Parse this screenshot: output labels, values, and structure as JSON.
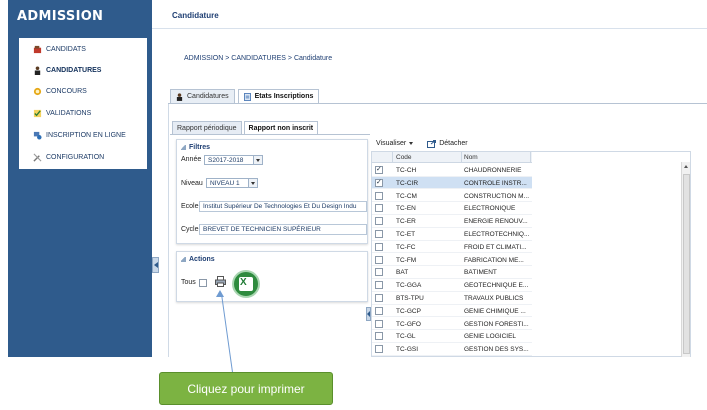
{
  "app": {
    "brand": "ADMISSION"
  },
  "sidebar": {
    "items": [
      {
        "label": "CANDIDATS",
        "icon": "candidates-icon",
        "active": false
      },
      {
        "label": "CANDIDATURES",
        "icon": "person-icon",
        "active": true
      },
      {
        "label": "CONCOURS",
        "icon": "contest-icon",
        "active": false
      },
      {
        "label": "VALIDATIONS",
        "icon": "validation-icon",
        "active": false
      },
      {
        "label": "INSCRIPTION EN LIGNE",
        "icon": "online-registration-icon",
        "active": false
      },
      {
        "label": "CONFIGURATION",
        "icon": "tools-icon",
        "active": false
      }
    ]
  },
  "header": {
    "title": "Candidature",
    "breadcrumb": "ADMISSION > CANDIDATURES > Candidature"
  },
  "tabs": [
    {
      "label": "Candidatures",
      "active": false
    },
    {
      "label": "Etats Inscriptions",
      "active": true
    }
  ],
  "subtabs": [
    {
      "label": "Rapport périodique",
      "active": false
    },
    {
      "label": "Rapport non inscrit",
      "active": true
    }
  ],
  "filters": {
    "title": "Filtres",
    "annee_label": "Année",
    "annee_value": "S2017-2018",
    "niveau_label": "Niveau",
    "niveau_value": "NIVEAU 1",
    "ecole_label": "Ecole",
    "ecole_value": "Institut Supérieur De Technologies Et Du Design Indu",
    "cycle_label": "Cycle",
    "cycle_value": "BREVET DE TECHNICIEN SUPÉRIEUR"
  },
  "actions": {
    "title": "Actions",
    "tous_label": "Tous"
  },
  "grid": {
    "toolbar": {
      "visualiser": "Visualiser",
      "detacher": "Détacher"
    },
    "columns": {
      "code": "Code",
      "nom": "Nom"
    },
    "rows": [
      {
        "code": "TC-CH",
        "nom": "CHAUDRONNERIE",
        "checked": true,
        "selected": false
      },
      {
        "code": "TC-CIR",
        "nom": "CONTROLE INSTR...",
        "checked": true,
        "selected": true
      },
      {
        "code": "TC-CM",
        "nom": "CONSTRUCTION M...",
        "checked": false,
        "selected": false
      },
      {
        "code": "TC-EN",
        "nom": "ELECTRONIQUE",
        "checked": false,
        "selected": false
      },
      {
        "code": "TC-ER",
        "nom": "ENERGIE RENOUV...",
        "checked": false,
        "selected": false
      },
      {
        "code": "TC-ET",
        "nom": "ELECTROTECHNIQ...",
        "checked": false,
        "selected": false
      },
      {
        "code": "TC-FC",
        "nom": "FROID ET CLIMATI...",
        "checked": false,
        "selected": false
      },
      {
        "code": "TC-FM",
        "nom": "FABRICATION ME...",
        "checked": false,
        "selected": false
      },
      {
        "code": "BAT",
        "nom": "BÂTIMENT",
        "checked": false,
        "selected": false
      },
      {
        "code": "TC-GGA",
        "nom": "GEOTECHNIQUE E...",
        "checked": false,
        "selected": false
      },
      {
        "code": "BTS-TPU",
        "nom": "TRAVAUX PUBLICS",
        "checked": false,
        "selected": false
      },
      {
        "code": "TC-GCP",
        "nom": "GENIE CHIMIQUE ...",
        "checked": false,
        "selected": false
      },
      {
        "code": "TC-GFO",
        "nom": "GESTION FORESTI...",
        "checked": false,
        "selected": false
      },
      {
        "code": "TC-GL",
        "nom": "GENIE LOGICIEL",
        "checked": false,
        "selected": false
      },
      {
        "code": "TC-GSI",
        "nom": "GESTION DES SYS...",
        "checked": false,
        "selected": false
      }
    ]
  },
  "callout": {
    "text": "Cliquez pour imprimer"
  },
  "colors": {
    "sidebar": "#2f5b8c",
    "accent": "#1f3f73",
    "callout": "#7cb342",
    "excel": "#2e8b3e"
  }
}
